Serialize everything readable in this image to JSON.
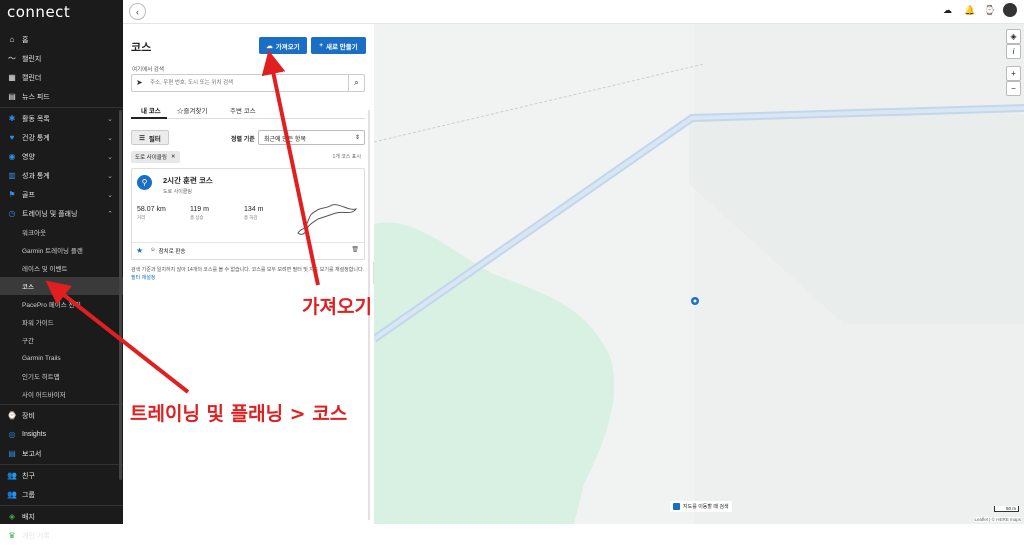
{
  "sidebar": {
    "logo": "connect",
    "items": [
      {
        "label": "홈",
        "icon": "home-icon",
        "glyph": "⌂"
      },
      {
        "label": "챌린지",
        "icon": "challenge-icon",
        "glyph": "〜"
      },
      {
        "label": "캘린더",
        "icon": "calendar-icon",
        "glyph": "▦"
      },
      {
        "label": "뉴스 피드",
        "icon": "news-icon",
        "glyph": "▤"
      }
    ],
    "groups": [
      {
        "label": "활동 목록",
        "icon": "activity-icon",
        "glyph": "✱"
      },
      {
        "label": "건강 통계",
        "icon": "heart-icon",
        "glyph": "♥"
      },
      {
        "label": "영양",
        "icon": "nutrition-icon",
        "glyph": "◉"
      },
      {
        "label": "성과 통계",
        "icon": "performance-icon",
        "glyph": "▥"
      },
      {
        "label": "골프",
        "icon": "golf-icon",
        "glyph": "⚑"
      },
      {
        "label": "트레이닝 및 플래닝",
        "icon": "training-icon",
        "glyph": "◷"
      }
    ],
    "training_sub": [
      "워크아웃",
      "Garmin 트레이닝 플랜",
      "레이스 및 이벤트",
      "코스",
      "PacePro 페이스 전략",
      "파워 가이드",
      "구간",
      "Garmin Trails",
      "인기도 히트맵",
      "사이 어드바이저"
    ],
    "bottom": [
      {
        "label": "장비",
        "icon": "device-icon",
        "glyph": "⌚"
      },
      {
        "label": "Insights",
        "icon": "insights-icon",
        "glyph": "◎"
      },
      {
        "label": "보고서",
        "icon": "report-icon",
        "glyph": "▤"
      },
      {
        "label": "친구",
        "icon": "friends-icon",
        "glyph": "👥"
      },
      {
        "label": "그룹",
        "icon": "groups-icon",
        "glyph": "👥"
      },
      {
        "label": "배지",
        "icon": "badge-icon",
        "glyph": "◈"
      },
      {
        "label": "개인 기록",
        "icon": "records-icon",
        "glyph": "♛"
      }
    ]
  },
  "panel": {
    "title": "코스",
    "import_label": "가져오기",
    "new_label": "새로 만들기",
    "search_label": "여기에서 검색",
    "search_placeholder": "주소, 우편 번호, 도시 또는 위치 검색",
    "tabs": [
      "내 코스",
      "즐겨찾기",
      "주변 코스"
    ],
    "filter_label": "필터",
    "sort_label": "정렬 기준",
    "sort_value": "최근에 만든 항목",
    "chip_label": "도로 사이클링",
    "count_text": "1개 코스 표시",
    "course": {
      "name": "2시간 훈련 코스",
      "type": "도로 사이클링",
      "stats": [
        {
          "value": "58.07 km",
          "label": "거리"
        },
        {
          "value": "119 m",
          "label": "총 상승"
        },
        {
          "value": "134 m",
          "label": "총 하강"
        }
      ],
      "privacy": "참치로 판송"
    },
    "note_text": "검색 기준과 일치하지 않아 14개의 코스를 볼 수 없습니다. 코스를 모두 보려면 필터 및 지도 보기를 재설정합니다.",
    "note_link": "필터 재설정"
  },
  "map": {
    "search_on_move": "지도를 이동할 때 검색",
    "scale": "50 m",
    "attribution": "Leaflet | © HERE maps"
  },
  "annotations": {
    "import_callout": "가져오기",
    "path_callout": "트레이닝 및 플래닝 > 코스"
  },
  "colors": {
    "accent": "#1a6fc4",
    "annotation": "#e02020",
    "sidebar": "#1b1b1b"
  }
}
